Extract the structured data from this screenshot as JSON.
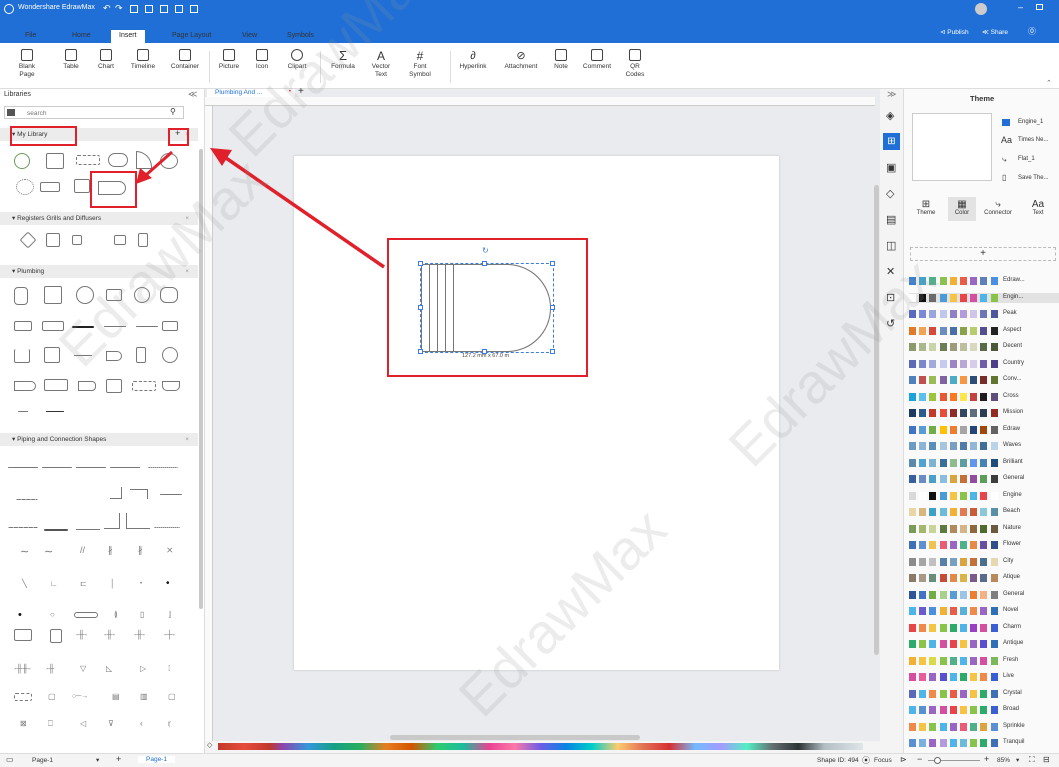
{
  "app": {
    "title": "Wondershare EdrawMax"
  },
  "menu": {
    "tabs": [
      "File",
      "Home",
      "Insert",
      "Page Layout",
      "View",
      "Symbols"
    ],
    "active": "Insert"
  },
  "titlebar": {
    "publish": "Publish",
    "share": "Share"
  },
  "ribbon": {
    "blank_page": "Blank Page",
    "table": "Table",
    "chart": "Chart",
    "timeline": "Timeline",
    "container": "Container",
    "picture": "Picture",
    "icon": "Icon",
    "clipart": "Clipart",
    "formula": "Formula",
    "vector_text": "Vector Text",
    "font_symbol": "Font Symbol",
    "hyperlink": "Hyperlink",
    "attachment": "Attachment",
    "note": "Note",
    "comment": "Comment",
    "qr_codes": "QR Codes"
  },
  "libraries": {
    "title": "Libraries",
    "search_placeholder": "search",
    "sections": [
      "My Library",
      "Registers Grills and Diffusers",
      "Plumbing",
      "Piping and Connection Shapes"
    ]
  },
  "document_tab": {
    "label": "Plumbing And ..."
  },
  "selection": {
    "dimensions": "127.2 mm x 67.0 m"
  },
  "theme_panel": {
    "title": "Theme",
    "preview_items": [
      "Engine_1",
      "Times Ne...",
      "Flat_1",
      "Save The..."
    ],
    "tabs": [
      "Theme",
      "Color",
      "Connector",
      "Text"
    ],
    "active_tab": "Color",
    "add_label": "+",
    "color_schemes": [
      {
        "name": "Edraw...",
        "colors": [
          "#3b7fd1",
          "#41a2c9",
          "#4fb08a",
          "#8cc152",
          "#f2b134",
          "#e85d4a",
          "#9a66c4",
          "#5f7fb8",
          "#4a8fe0"
        ]
      },
      {
        "name": "Engin...",
        "colors": [
          "#ffffff",
          "#111111",
          "#6b6b6b",
          "#4a9bd6",
          "#f6c445",
          "#e8454a",
          "#d44fa0",
          "#4fb5e8",
          "#8ac34a"
        ]
      },
      {
        "name": "Peak",
        "colors": [
          "#5b6abf",
          "#7c8ad6",
          "#9aa5de",
          "#c0c7ec",
          "#8f7fc7",
          "#b39cdb",
          "#d1c4e9",
          "#6d77b8",
          "#4e579c"
        ]
      },
      {
        "name": "Aspect",
        "colors": [
          "#e07b2b",
          "#f0a350",
          "#d44a3a",
          "#6c8ebf",
          "#4a6fa5",
          "#8aa14d",
          "#b8cc6e",
          "#554e8c",
          "#222222"
        ]
      },
      {
        "name": "Decent",
        "colors": [
          "#8a9a6b",
          "#a9b98b",
          "#c9d4a9",
          "#6b7c57",
          "#9c9c7a",
          "#bdbda0",
          "#d8d8c0",
          "#5a6a48",
          "#4a5a38"
        ]
      },
      {
        "name": "Country",
        "colors": [
          "#5c6ab8",
          "#7b88cc",
          "#a0aadd",
          "#c4cbec",
          "#9a86c4",
          "#b8a8d8",
          "#d7cdea",
          "#6e5fa8",
          "#4d3f8a"
        ]
      },
      {
        "name": "Conv...",
        "colors": [
          "#4f81bd",
          "#c0504d",
          "#9bbb59",
          "#8064a2",
          "#4bacc6",
          "#f79646",
          "#2c4d75",
          "#772c2a",
          "#5f7530"
        ]
      },
      {
        "name": "Cross",
        "colors": [
          "#1aa3d8",
          "#5bc0eb",
          "#9bc53d",
          "#e55934",
          "#fa7921",
          "#fde74c",
          "#c3423f",
          "#211a1e",
          "#5c4d7d"
        ]
      },
      {
        "name": "Mission",
        "colors": [
          "#1e3a5f",
          "#2e5c8a",
          "#c0392b",
          "#e74c3c",
          "#8e2b2b",
          "#34495e",
          "#5d6d7e",
          "#2c3e50",
          "#922b21"
        ]
      },
      {
        "name": "Edraw",
        "colors": [
          "#4472c4",
          "#5b9bd5",
          "#70ad47",
          "#ffc000",
          "#ed7d31",
          "#a5a5a5",
          "#264478",
          "#9e480e",
          "#636363"
        ]
      },
      {
        "name": "Waves",
        "colors": [
          "#6b9bc3",
          "#8bb4d6",
          "#5a8db8",
          "#a6c6e0",
          "#7a9ec0",
          "#4f7da8",
          "#93b7d6",
          "#3f6e98",
          "#b9d3ea"
        ]
      },
      {
        "name": "Brilliant",
        "colors": [
          "#5d8aa8",
          "#4fa3d1",
          "#7fb3d5",
          "#3b6e99",
          "#8fbc8f",
          "#5f9ea0",
          "#6495ed",
          "#4682b4",
          "#1e4d7a"
        ]
      },
      {
        "name": "General",
        "colors": [
          "#3a5fa0",
          "#6a8bc3",
          "#4aa0c9",
          "#8bbde0",
          "#d9a441",
          "#c4703a",
          "#8f4f9e",
          "#5a9e5a",
          "#3d3d3d"
        ]
      },
      {
        "name": "Engine",
        "colors": [
          "#d9d9d9",
          "#ffffff",
          "#111111",
          "#4a9bd6",
          "#f6c445",
          "#8ac34a",
          "#4fb5e8",
          "#e8454a",
          "#ffffff"
        ]
      },
      {
        "name": "Beach",
        "colors": [
          "#e8d5a9",
          "#d9b77a",
          "#3f9fc7",
          "#6dbbd9",
          "#f2b134",
          "#e07b53",
          "#c95c3a",
          "#8cc6d9",
          "#5a8fa8"
        ]
      },
      {
        "name": "Nature",
        "colors": [
          "#7c9a5a",
          "#a3b86c",
          "#c9d49a",
          "#5f7a3e",
          "#b08a5a",
          "#d4b48a",
          "#8c6a3e",
          "#4f6b2e",
          "#6b5a3e"
        ]
      },
      {
        "name": "Flower",
        "colors": [
          "#3f6fb5",
          "#5d8fd1",
          "#f2c14e",
          "#e85d75",
          "#9a66c4",
          "#4fb08a",
          "#e8894a",
          "#6a4fa0",
          "#2e4f8a"
        ]
      },
      {
        "name": "City",
        "colors": [
          "#8c8c8c",
          "#a6a6a6",
          "#c0c0c0",
          "#5a7fa8",
          "#7a9ec0",
          "#d9a441",
          "#c4703a",
          "#4a6f8c",
          "#e6d9b0"
        ]
      },
      {
        "name": "Atique",
        "colors": [
          "#8a7a6a",
          "#a89888",
          "#6a8c7a",
          "#c44a3a",
          "#e08a4a",
          "#d9b44a",
          "#7a5a8a",
          "#5a6a8a",
          "#b88a5a"
        ]
      },
      {
        "name": "General",
        "colors": [
          "#2f5597",
          "#4472c4",
          "#70ad47",
          "#a9d18e",
          "#5b9bd5",
          "#9dc3e6",
          "#ed7d31",
          "#f4b183",
          "#7f7f7f"
        ]
      },
      {
        "name": "Novel",
        "colors": [
          "#4fb5e8",
          "#6a5acd",
          "#4a8fe0",
          "#f2b134",
          "#e85d4a",
          "#5ab0d9",
          "#f08a4a",
          "#9a66c4",
          "#2e6fb5"
        ]
      },
      {
        "name": "Charm",
        "colors": [
          "#e8454a",
          "#f08a4a",
          "#f6c445",
          "#8ac34a",
          "#2eaa6a",
          "#4fb5e8",
          "#9a3fc4",
          "#d44fa0",
          "#3b5fd1"
        ]
      },
      {
        "name": "Antique",
        "colors": [
          "#2eaa6a",
          "#8ac34a",
          "#4fb5e8",
          "#d44fa0",
          "#e8454a",
          "#f6c445",
          "#9a66c4",
          "#5a4fcf",
          "#2e6fb5"
        ]
      },
      {
        "name": "Fresh",
        "colors": [
          "#f2b134",
          "#f6c445",
          "#d9d94a",
          "#8ac34a",
          "#4fb08a",
          "#4fb5e8",
          "#9a66c4",
          "#d44fa0",
          "#7ab85a"
        ]
      },
      {
        "name": "Live",
        "colors": [
          "#d44fa0",
          "#e85d9a",
          "#9a66c4",
          "#5a4fcf",
          "#4fb5e8",
          "#2eaa6a",
          "#f6c445",
          "#f08a4a",
          "#3b5fd1"
        ]
      },
      {
        "name": "Crystal",
        "colors": [
          "#5a6ab8",
          "#4fb5e8",
          "#f08a4a",
          "#8ac34a",
          "#e85d4a",
          "#9a66c4",
          "#f6c445",
          "#2eaa6a",
          "#3f6fb5"
        ]
      },
      {
        "name": "Broad",
        "colors": [
          "#4fb5e8",
          "#5a8fd1",
          "#9a66c4",
          "#d44fa0",
          "#e8454a",
          "#f6c445",
          "#8ac34a",
          "#2eaa6a",
          "#3b5fd1"
        ]
      },
      {
        "name": "Sprinkle",
        "colors": [
          "#f08a4a",
          "#f6c445",
          "#8ac34a",
          "#4fb5e8",
          "#9a66c4",
          "#e85d75",
          "#4fb08a",
          "#d9a441",
          "#5a8fd1"
        ]
      },
      {
        "name": "Tranquil",
        "colors": [
          "#5a8fd1",
          "#7ab0e0",
          "#9a66c4",
          "#b39cdb",
          "#4fb5e8",
          "#6dbbd9",
          "#8ac34a",
          "#2eaa6a",
          "#3f6fb5"
        ]
      }
    ]
  },
  "status": {
    "page_select": "Page-1",
    "page_tab": "Page-1",
    "shape_id": "Shape ID: 494",
    "focus": "Focus",
    "zoom": "85%"
  },
  "watermark": "EdrawMax",
  "colors": {
    "brand": "#1f6fd6",
    "highlight": "#e0202a",
    "selection": "#3d7be0"
  }
}
